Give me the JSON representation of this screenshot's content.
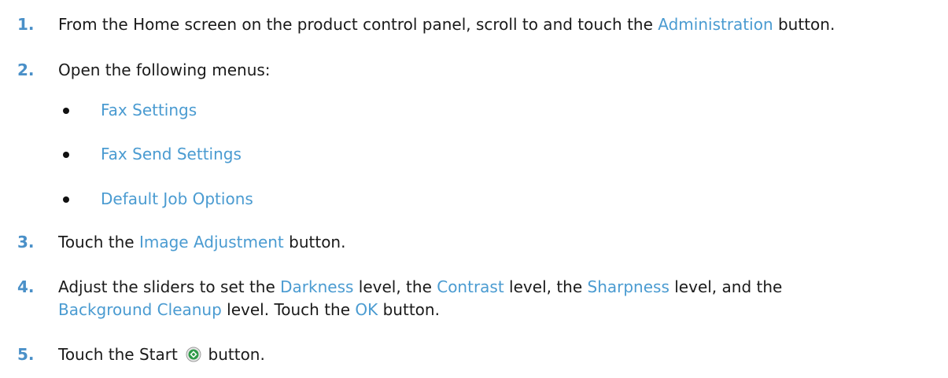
{
  "steps": [
    {
      "num": "1.",
      "t1": "From the Home screen on the product control panel, scroll to and touch the ",
      "h1": "Administration",
      "t2": " button."
    },
    {
      "num": "2.",
      "t1": "Open the following menus:"
    },
    {
      "num": "3.",
      "t1": "Touch the ",
      "h1": "Image Adjustment",
      "t2": " button."
    },
    {
      "num": "4.",
      "t1": "Adjust the sliders to set the ",
      "h1": "Darkness",
      "t2": " level, the ",
      "h2": "Contrast",
      "t3": " level, the ",
      "h3": "Sharpness",
      "t4": " level, and the",
      "h4": "Background Cleanup",
      "t5": " level. Touch the ",
      "h5": "OK",
      "t6": " button."
    },
    {
      "num": "5.",
      "t1": "Touch the Start ",
      "t2": " button."
    }
  ],
  "menus": [
    "Fax Settings",
    "Fax Send Settings",
    "Default Job Options"
  ],
  "colors": {
    "step_number": "#4a90c8",
    "highlight": "#4a9bd1",
    "start_icon_green": "#2e9a48"
  },
  "icons": {
    "start": "start-button-icon"
  }
}
